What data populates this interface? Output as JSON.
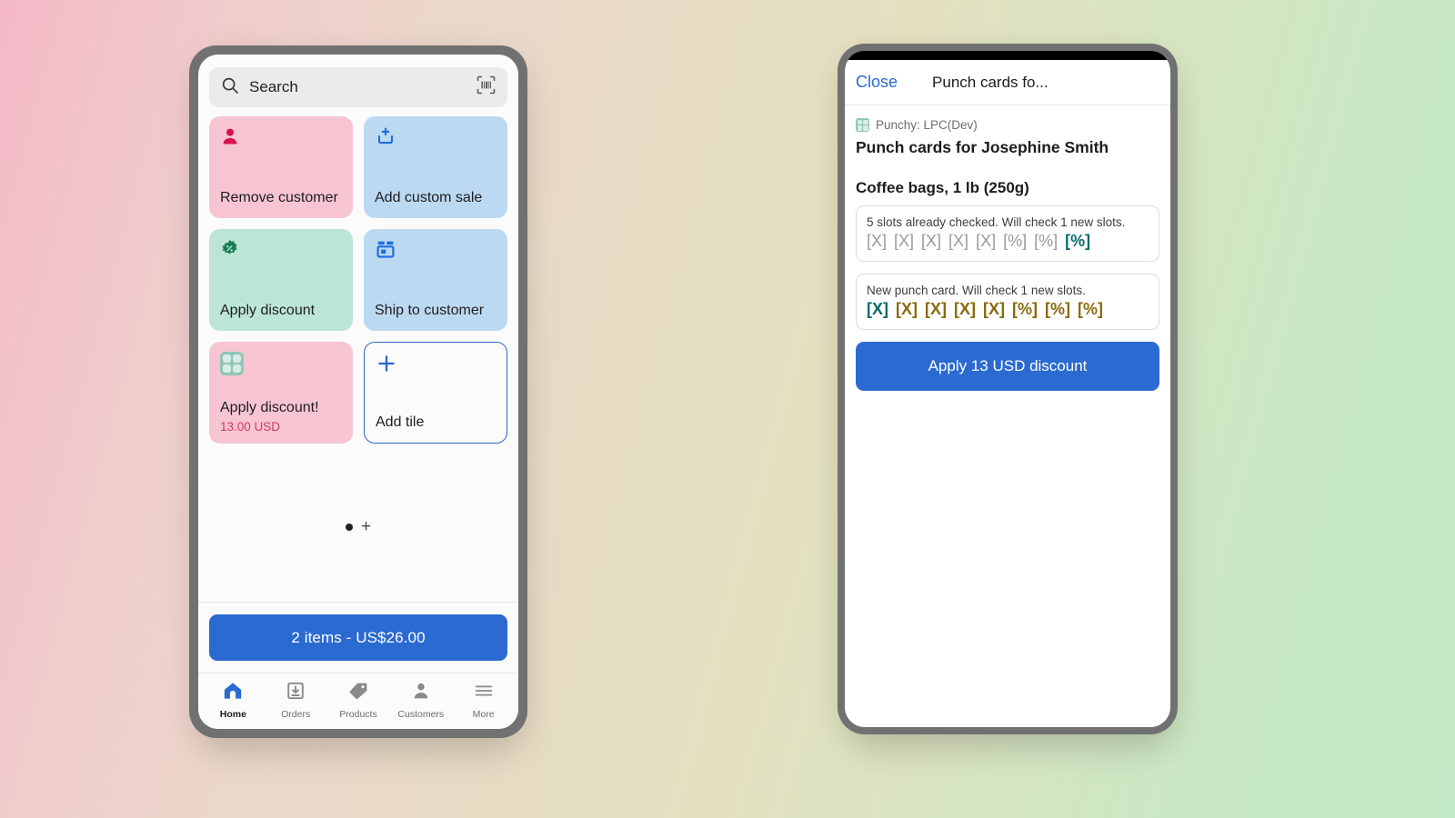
{
  "background": {
    "gradient_from": "#f5b9c8",
    "gradient_mid": "#e3e0bf",
    "gradient_to": "#c3eac6"
  },
  "left_phone": {
    "search": {
      "placeholder": "Search",
      "value": "Search",
      "search_icon": "search-icon",
      "scan_icon": "barcode-scan-icon"
    },
    "tiles": [
      {
        "label": "Remove customer",
        "sub": "",
        "icon": "person-icon",
        "color": "#f7c5d2",
        "icon_color": "#d8124f",
        "style": "pink"
      },
      {
        "label": "Add custom sale",
        "sub": "",
        "icon": "add-to-basket-icon",
        "color": "#bcd9f2",
        "icon_color": "#1f6fdb",
        "style": "blue"
      },
      {
        "label": "Apply discount",
        "sub": "",
        "icon": "discount-badge-icon",
        "color": "#bde5d5",
        "icon_color": "#167d51",
        "style": "green"
      },
      {
        "label": "Ship to customer",
        "sub": "",
        "icon": "shipping-box-icon",
        "color": "#bcd9f2",
        "icon_color": "#1f6fdb",
        "style": "blue"
      },
      {
        "label": "Apply discount!",
        "sub": "13.00 USD",
        "icon": "punchy-app-icon",
        "color": "#f7c5d2",
        "icon_color": "#8fc6b8",
        "style": "pink"
      },
      {
        "label": "Add tile",
        "sub": "",
        "icon": "plus-icon",
        "color": "#fbfbfb",
        "icon_color": "#2b66c9",
        "style": "add"
      }
    ],
    "pager": {
      "dot": "page-dot",
      "add_page": "+"
    },
    "cart_button": {
      "label": "2 items - US$26.00",
      "color": "#2b6ad1",
      "item_count": 2,
      "total": "US$26.00"
    },
    "bottom_nav": [
      {
        "label": "Home",
        "icon": "home-icon",
        "active": true
      },
      {
        "label": "Orders",
        "icon": "orders-inbox-icon",
        "active": false
      },
      {
        "label": "Products",
        "icon": "price-tag-icon",
        "active": false
      },
      {
        "label": "Customers",
        "icon": "person-icon",
        "active": false
      },
      {
        "label": "More",
        "icon": "hamburger-menu-icon",
        "active": false
      }
    ]
  },
  "right_phone": {
    "header": {
      "close_label": "Close",
      "title": "Punch cards fo...",
      "close_color": "#2b6ad1"
    },
    "app_row": {
      "app_label": "Punchy: LPC(Dev)",
      "app_icon": "punchy-app-icon"
    },
    "page_heading": "Punch cards for Josephine Smith",
    "product_heading": "Coffee bags, 1 lb (250g)",
    "cards": [
      {
        "text": "5 slots already checked. Will check 1 new slots.",
        "slots": [
          {
            "label": "[X]",
            "state": "muted"
          },
          {
            "label": "[X]",
            "state": "muted"
          },
          {
            "label": "[X]",
            "state": "muted"
          },
          {
            "label": "[X]",
            "state": "muted"
          },
          {
            "label": "[X]",
            "state": "muted"
          },
          {
            "label": "[%]",
            "state": "muted"
          },
          {
            "label": "[%]",
            "state": "muted"
          },
          {
            "label": "[%]",
            "state": "teal"
          }
        ]
      },
      {
        "text": "New punch card. Will check 1 new slots.",
        "slots": [
          {
            "label": "[X]",
            "state": "teal"
          },
          {
            "label": "[X]",
            "state": "gold"
          },
          {
            "label": "[X]",
            "state": "gold"
          },
          {
            "label": "[X]",
            "state": "gold"
          },
          {
            "label": "[X]",
            "state": "gold"
          },
          {
            "label": "[%]",
            "state": "gold"
          },
          {
            "label": "[%]",
            "state": "gold"
          },
          {
            "label": "[%]",
            "state": "gold"
          }
        ]
      }
    ],
    "apply_button": {
      "label": "Apply 13 USD discount",
      "color": "#2b6ad1",
      "amount": "13",
      "currency": "USD"
    }
  }
}
